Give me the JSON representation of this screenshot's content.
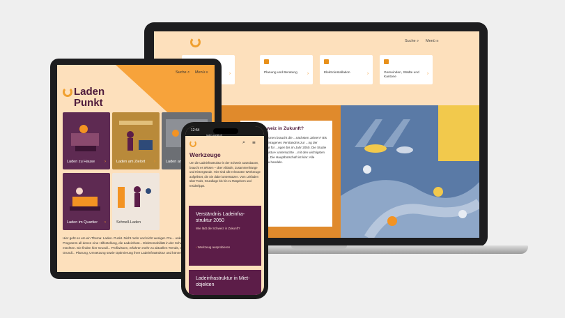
{
  "laptop": {
    "search_label": "Suche",
    "menu_label": "Menü",
    "cards": [
      {
        "label": "...ne"
      },
      {
        "label": "Planung und Beratung"
      },
      {
        "label": "Elektroinstallation"
      },
      {
        "label": "Gemeinden, Städte und Kantone"
      }
    ],
    "feature": {
      "title": "...die Schweiz in Zukunft?",
      "body": "...l von Ladeoptionen braucht die ...nächsten Jahren? Bis wohin ...rsam getragenes Verständnis zur ...ng der Ladeinfrastruktur für ...ngen bis im Jahr 2050. Die Studie ...r Ladeinfrastruktur« untersuchte ...mit den wichtigsten Akteurinnen ...n. Die Hauptbotschaft ist klar: Alle ...fordert, jetzt zu handeln.",
      "link": "...ur 2050"
    }
  },
  "tablet": {
    "logo_line1": "Laden",
    "logo_line2": "Punkt",
    "search_label": "Suche",
    "menu_label": "Menü",
    "tiles": [
      {
        "label": "Laden zu Hause"
      },
      {
        "label": "Laden am Zielort"
      },
      {
        "label": "Laden am Arbeitsp..."
      },
      {
        "label": "Laden im Quartier"
      },
      {
        "label": "Schnell-Laden"
      }
    ],
    "body": "Hier geht es um ein Thema: Laden. Punkt. Nicht mehr und nicht weniger. Pra... unkompliziert gibt das Programm all denen eine Hilfestellung, die Ladeinfrast... Elektromobilität in der Schweiz vorantreiben möchten. Sie finden hier Grundl... Profiwissen, erfahren mehr zu aktuellen Trends, erhalten verlässliche Grundl... Planung, Umsetzung sowie Optimierung ihrer Ladeinfrastruktur und können s..."
  },
  "phone": {
    "time": "12:54",
    "url": "laden-punkt.ch",
    "title": "Werkzeuge",
    "text": "Um die Ladeinfrastruktur in der Schweiz auszubauen, braucht es Wissen – über Abläufe, Zusammenhänge und Hintergründe. Hier sind alle relevanten Werkzeuge aufgelistet, die Sie dabei unterstützen. Vom Leitfaden über Tools, Grundlage bis hin zu Ratgebern und Insiderlipps.",
    "card1": {
      "title": "Verständnis Ladeinfra-struktur 2050",
      "subtitle": "Wie lädt die Schweiz in Zukunft?",
      "link": "Werkzeug ausprobieren"
    },
    "card2": {
      "title": "Ladeinfrastruktur in Miet-objekten"
    }
  },
  "colors": {
    "brand_orange": "#f39323",
    "brand_plum": "#5c1d48",
    "page_peach": "#fde0bc"
  }
}
